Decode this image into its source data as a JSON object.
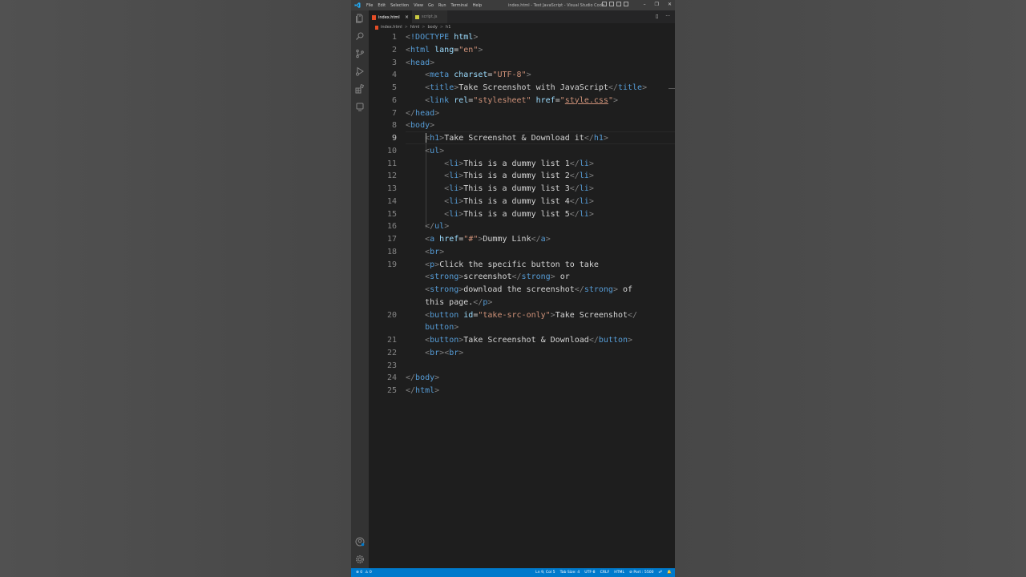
{
  "window": {
    "title": "index.html - Test JavaScript - Visual Studio Code",
    "menu": [
      "File",
      "Edit",
      "Selection",
      "View",
      "Go",
      "Run",
      "Terminal",
      "Help"
    ],
    "controls": [
      "–",
      "❐",
      "✕"
    ]
  },
  "tabs": [
    {
      "label": "index.html",
      "active": true,
      "icon": "html5-icon"
    },
    {
      "label": "script.js",
      "active": false,
      "icon": "js-icon"
    }
  ],
  "tab_close": "×",
  "tab_actions": [
    "▯",
    "···"
  ],
  "breadcrumb": [
    "index.html",
    "html",
    "body",
    "h1"
  ],
  "breadcrumb_sep": ">",
  "activity_icons": [
    "explorer-icon",
    "search-icon",
    "source-control-icon",
    "run-debug-icon",
    "extensions-icon",
    "remote-explorer-icon",
    "accounts-icon",
    "settings-gear-icon"
  ],
  "editor": {
    "current_line": 9,
    "line_numbers": [
      "1",
      "2",
      "3",
      "4",
      "5",
      "6",
      "7",
      "8",
      "9",
      "10",
      "11",
      "12",
      "13",
      "14",
      "15",
      "16",
      "17",
      "18",
      "19",
      "",
      "",
      "",
      "20",
      "",
      "21",
      "22",
      "23",
      "24",
      "25"
    ],
    "lines": [
      [
        [
          "p",
          "<"
        ],
        [
          "t",
          "!DOCTYPE "
        ],
        [
          "a",
          "html"
        ],
        [
          "p",
          ">"
        ]
      ],
      [
        [
          "p",
          "<"
        ],
        [
          "t",
          "html "
        ],
        [
          "a",
          "lang"
        ],
        [
          "x",
          "="
        ],
        [
          "s",
          "\"en\""
        ],
        [
          "p",
          ">"
        ]
      ],
      [
        [
          "p",
          "<"
        ],
        [
          "t",
          "head"
        ],
        [
          "p",
          ">"
        ]
      ],
      [
        [
          "x",
          "    "
        ],
        [
          "p",
          "<"
        ],
        [
          "t",
          "meta "
        ],
        [
          "a",
          "charset"
        ],
        [
          "x",
          "="
        ],
        [
          "s",
          "\"UTF-8\""
        ],
        [
          "p",
          ">"
        ]
      ],
      [
        [
          "x",
          "    "
        ],
        [
          "p",
          "<"
        ],
        [
          "t",
          "title"
        ],
        [
          "p",
          ">"
        ],
        [
          "x",
          "Take Screenshot with JavaScript"
        ],
        [
          "p",
          "</"
        ],
        [
          "t",
          "title"
        ],
        [
          "p",
          ">"
        ]
      ],
      [
        [
          "x",
          "    "
        ],
        [
          "p",
          "<"
        ],
        [
          "t",
          "link "
        ],
        [
          "a",
          "rel"
        ],
        [
          "x",
          "="
        ],
        [
          "s",
          "\"stylesheet\""
        ],
        [
          "x",
          " "
        ],
        [
          "a",
          "href"
        ],
        [
          "x",
          "="
        ],
        [
          "s",
          "\""
        ],
        [
          "u",
          "style.css"
        ],
        [
          "s",
          "\""
        ],
        [
          "p",
          ">"
        ]
      ],
      [
        [
          "p",
          "</"
        ],
        [
          "t",
          "head"
        ],
        [
          "p",
          ">"
        ]
      ],
      [
        [
          "p",
          "<"
        ],
        [
          "t",
          "body"
        ],
        [
          "p",
          ">"
        ]
      ],
      [
        [
          "x",
          "    "
        ],
        [
          "p",
          "<"
        ],
        [
          "t",
          "h1"
        ],
        [
          "p",
          ">"
        ],
        [
          "x",
          "Take Screenshot & Download it"
        ],
        [
          "p",
          "</"
        ],
        [
          "t",
          "h1"
        ],
        [
          "p",
          ">"
        ]
      ],
      [
        [
          "x",
          "    "
        ],
        [
          "p",
          "<"
        ],
        [
          "t",
          "ul"
        ],
        [
          "p",
          ">"
        ]
      ],
      [
        [
          "x",
          "        "
        ],
        [
          "p",
          "<"
        ],
        [
          "t",
          "li"
        ],
        [
          "p",
          ">"
        ],
        [
          "x",
          "This is a dummy list 1"
        ],
        [
          "p",
          "</"
        ],
        [
          "t",
          "li"
        ],
        [
          "p",
          ">"
        ]
      ],
      [
        [
          "x",
          "        "
        ],
        [
          "p",
          "<"
        ],
        [
          "t",
          "li"
        ],
        [
          "p",
          ">"
        ],
        [
          "x",
          "This is a dummy list 2"
        ],
        [
          "p",
          "</"
        ],
        [
          "t",
          "li"
        ],
        [
          "p",
          ">"
        ]
      ],
      [
        [
          "x",
          "        "
        ],
        [
          "p",
          "<"
        ],
        [
          "t",
          "li"
        ],
        [
          "p",
          ">"
        ],
        [
          "x",
          "This is a dummy list 3"
        ],
        [
          "p",
          "</"
        ],
        [
          "t",
          "li"
        ],
        [
          "p",
          ">"
        ]
      ],
      [
        [
          "x",
          "        "
        ],
        [
          "p",
          "<"
        ],
        [
          "t",
          "li"
        ],
        [
          "p",
          ">"
        ],
        [
          "x",
          "This is a dummy list 4"
        ],
        [
          "p",
          "</"
        ],
        [
          "t",
          "li"
        ],
        [
          "p",
          ">"
        ]
      ],
      [
        [
          "x",
          "        "
        ],
        [
          "p",
          "<"
        ],
        [
          "t",
          "li"
        ],
        [
          "p",
          ">"
        ],
        [
          "x",
          "This is a dummy list 5"
        ],
        [
          "p",
          "</"
        ],
        [
          "t",
          "li"
        ],
        [
          "p",
          ">"
        ]
      ],
      [
        [
          "x",
          "    "
        ],
        [
          "p",
          "</"
        ],
        [
          "t",
          "ul"
        ],
        [
          "p",
          ">"
        ]
      ],
      [
        [
          "x",
          "    "
        ],
        [
          "p",
          "<"
        ],
        [
          "t",
          "a "
        ],
        [
          "a",
          "href"
        ],
        [
          "x",
          "="
        ],
        [
          "s",
          "\"#\""
        ],
        [
          "p",
          ">"
        ],
        [
          "x",
          "Dummy Link"
        ],
        [
          "p",
          "</"
        ],
        [
          "t",
          "a"
        ],
        [
          "p",
          ">"
        ]
      ],
      [
        [
          "x",
          "    "
        ],
        [
          "p",
          "<"
        ],
        [
          "t",
          "br"
        ],
        [
          "p",
          ">"
        ]
      ],
      [
        [
          "x",
          "    "
        ],
        [
          "p",
          "<"
        ],
        [
          "t",
          "p"
        ],
        [
          "p",
          ">"
        ],
        [
          "x",
          "Click the specific button to take"
        ]
      ],
      [
        [
          "x",
          "    "
        ],
        [
          "p",
          "<"
        ],
        [
          "t",
          "strong"
        ],
        [
          "p",
          ">"
        ],
        [
          "x",
          "screenshot"
        ],
        [
          "p",
          "</"
        ],
        [
          "t",
          "strong"
        ],
        [
          "p",
          "> "
        ],
        [
          "x",
          "or"
        ]
      ],
      [
        [
          "x",
          "    "
        ],
        [
          "p",
          "<"
        ],
        [
          "t",
          "strong"
        ],
        [
          "p",
          ">"
        ],
        [
          "x",
          "download the screenshot"
        ],
        [
          "p",
          "</"
        ],
        [
          "t",
          "strong"
        ],
        [
          "p",
          "> "
        ],
        [
          "x",
          "of"
        ]
      ],
      [
        [
          "x",
          "    this page."
        ],
        [
          "p",
          "</"
        ],
        [
          "t",
          "p"
        ],
        [
          "p",
          ">"
        ]
      ],
      [
        [
          "x",
          "    "
        ],
        [
          "p",
          "<"
        ],
        [
          "t",
          "button "
        ],
        [
          "a",
          "id"
        ],
        [
          "x",
          "="
        ],
        [
          "s",
          "\"take-src-only\""
        ],
        [
          "p",
          ">"
        ],
        [
          "x",
          "Take Screenshot"
        ],
        [
          "p",
          "</"
        ]
      ],
      [
        [
          "x",
          "    "
        ],
        [
          "t",
          "button"
        ],
        [
          "p",
          ">"
        ]
      ],
      [
        [
          "x",
          "    "
        ],
        [
          "p",
          "<"
        ],
        [
          "t",
          "button"
        ],
        [
          "p",
          ">"
        ],
        [
          "x",
          "Take Screenshot & Download"
        ],
        [
          "p",
          "</"
        ],
        [
          "t",
          "button"
        ],
        [
          "p",
          ">"
        ]
      ],
      [
        [
          "x",
          "    "
        ],
        [
          "p",
          "<"
        ],
        [
          "t",
          "br"
        ],
        [
          "p",
          "><"
        ],
        [
          "t",
          "br"
        ],
        [
          "p",
          ">"
        ]
      ],
      [],
      [
        [
          "p",
          "</"
        ],
        [
          "t",
          "body"
        ],
        [
          "p",
          ">"
        ]
      ],
      [
        [
          "p",
          "</"
        ],
        [
          "t",
          "html"
        ],
        [
          "p",
          ">"
        ]
      ]
    ]
  },
  "status_bar": {
    "left": [
      "⊗ 0",
      "⚠ 0"
    ],
    "right": [
      "Ln 9, Col 5",
      "Tab Size: 4",
      "UTF-8",
      "CRLF",
      "HTML",
      "⊘ Port : 5500",
      "☍",
      "🔔"
    ]
  },
  "colors": {
    "background": "#4b4b4b",
    "editor": "#1e1e1e",
    "statusbar": "#007acc",
    "tag": "#569cd6",
    "attribute": "#9cdcfe",
    "string": "#ce9178"
  }
}
